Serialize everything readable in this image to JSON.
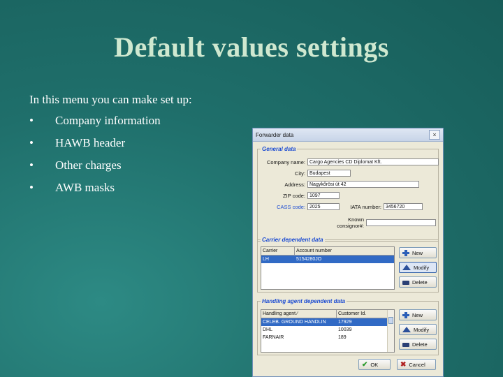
{
  "slide": {
    "title": "Default values settings",
    "intro": "In this menu you can make set up:",
    "bullet_glyph": "•",
    "bullets": [
      "Company information",
      "HAWB header",
      "Other charges",
      "AWB masks"
    ]
  },
  "dialog": {
    "title": "Forwarder data",
    "close_glyph": "×",
    "general": {
      "legend": "General data",
      "company_name_label": "Company name:",
      "company_name_value": "Cargo Agencies CD Diplomat Kft.",
      "city_label": "City:",
      "city_value": "Budapest",
      "address_label": "Address:",
      "address_value": "Nagykőrösi út 42",
      "zip_label": "ZIP code:",
      "zip_value": "1097",
      "cass_label": "CASS code:",
      "cass_value": "2025",
      "iata_label": "IATA number:",
      "iata_value": "3456720",
      "known_label": "Known consignor#:",
      "known_value": ""
    },
    "carrier": {
      "legend": "Carrier dependent data",
      "columns": [
        "Carrier",
        "Account number"
      ],
      "rows": [
        [
          "LH",
          "5154280JO"
        ]
      ],
      "buttons": {
        "new": "New",
        "modify": "Modify",
        "delete": "Delete"
      }
    },
    "handling": {
      "legend": "Handling agent dependent data",
      "columns": [
        "Handling agent ∕",
        "Customer Id."
      ],
      "rows": [
        [
          "CELEB. GROUND HANDLIN",
          "17929"
        ],
        [
          "DHL",
          "10039"
        ],
        [
          "FARNAIR",
          "189"
        ]
      ],
      "buttons": {
        "new": "New",
        "modify": "Modify",
        "delete": "Delete"
      }
    },
    "footer": {
      "ok": "OK",
      "cancel": "Cancel"
    }
  }
}
